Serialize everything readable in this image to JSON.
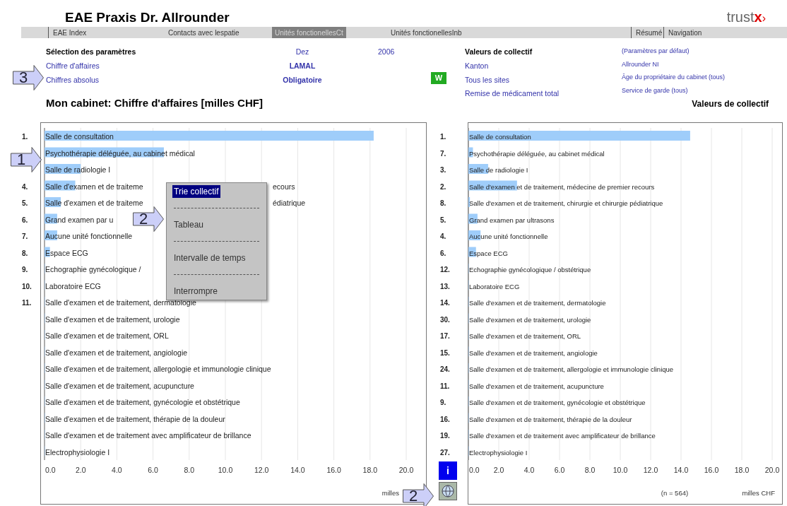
{
  "header": {
    "title": "EAE Praxis Dr. Allrounder",
    "logo": {
      "text": "trust",
      "accent": "x",
      "mark": "›"
    }
  },
  "nav": [
    {
      "label": "EAE Index",
      "selected": false,
      "divider": true
    },
    {
      "label": "Contacts avec lespatie",
      "selected": false,
      "divider": false
    },
    {
      "label": "Unités fonctionellesCt",
      "selected": true,
      "divider": false
    },
    {
      "label": "Unités fonctionellesInb",
      "selected": false,
      "divider": false
    },
    {
      "label": "Résumé",
      "selected": false,
      "divider": true
    },
    {
      "label": "Navigation",
      "selected": false,
      "divider": true
    }
  ],
  "parameters": {
    "selection": {
      "heading": "Sélection des paramètres",
      "items": [
        "Chiffre d'affaires",
        "Chiffres absolus"
      ]
    },
    "period": [
      "Dez",
      "2006"
    ],
    "insurance": [
      "LAMAL",
      "Obligatoire"
    ],
    "w_button": "W",
    "collective": {
      "heading": "Valeurs de collectif",
      "items": [
        "Kanton",
        "Tous les sites",
        "Remise de médicament total"
      ]
    },
    "defaults": [
      "(Paramètres par défaut)",
      "Allrounder NI",
      "Âge du propriétaire du cabinet (tous)",
      "Service de garde (tous)"
    ]
  },
  "left_panel": {
    "title": "Mon cabinet: Chiffre d'affaires [milles CHF]",
    "ranks_above_callout": [
      "1."
    ],
    "ranks": [
      "4.",
      "5.",
      "6.",
      "7.",
      "8.",
      "9.",
      "10.",
      "11."
    ],
    "label_tails": [
      "ecours",
      "édiatrique"
    ],
    "chart_data": {
      "type": "bar",
      "orientation": "horizontal",
      "grid": true,
      "xlabel": "milles",
      "categories": [
        "Salle de consultation",
        "Psychothérapie déléguée, au cabinet médical",
        "Salle de radiologie I",
        "Salle d'examen et de traiteme",
        "Salle d'examen et de traiteme",
        "Grand examen par u",
        "Aucune unité fonctionnelle",
        "Espace ECG",
        "Echographie gynécologique /",
        "Laboratoire ECG",
        "Salle d'examen et de traitement, dermatologie",
        "Salle d'examen et de traitement, urologie",
        "Salle d'examen et de traitement, ORL",
        "Salle d'examen et de traitement, angiologie",
        "Salle d'examen et de traitement, allergologie et immunologie clinique",
        "Salle d'examen et de traitement, acupuncture",
        "Salle d'examen et de traitement, gynécologie et obstétrique",
        "Salle d'examen et de traitement, thérapie de la douleur",
        "Salle d'examen et de traitement avec amplificateur de brillance",
        "Electrophysiologie I"
      ],
      "values": [
        18.2,
        6.6,
        2.0,
        1.7,
        0.9,
        0.7,
        0.7,
        0.3,
        0,
        0,
        0,
        0,
        0,
        0,
        0,
        0,
        0,
        0,
        0,
        0
      ],
      "xlim": [
        0,
        20
      ],
      "xticks": [
        {
          "value": 0,
          "label": "0.0"
        },
        {
          "value": 2,
          "label": "2.0"
        },
        {
          "value": 4,
          "label": "4.0"
        },
        {
          "value": 6,
          "label": "6.0"
        },
        {
          "value": 8,
          "label": "8.0"
        },
        {
          "value": 10,
          "label": "10.0"
        },
        {
          "value": 12,
          "label": "12.0"
        },
        {
          "value": 14,
          "label": "14.0"
        },
        {
          "value": 16,
          "label": "16.0"
        },
        {
          "value": 18,
          "label": "18.0"
        },
        {
          "value": 20,
          "label": "20.0"
        }
      ]
    }
  },
  "right_panel": {
    "title": "Valeurs de collectif",
    "ranks": [
      "1.",
      "7.",
      "3.",
      "2.",
      "8.",
      "5.",
      "4.",
      "6.",
      "12.",
      "13.",
      "14.",
      "30.",
      "17.",
      "15.",
      "24.",
      "11.",
      "9.",
      "16.",
      "19.",
      "27."
    ],
    "note": "(n = 564)",
    "chart_data": {
      "type": "bar",
      "orientation": "horizontal",
      "grid": true,
      "xlabel": "milles CHF",
      "categories": [
        "Salle de consultation",
        "Psychothérapie déléguée, au cabinet médical",
        "Salle de radiologie I",
        "Salle d'examen et de traitement, médecine de premier recours",
        "Salle d'examen et de traitement, chirurgie et chirurgie pédiatrique",
        "Grand examen par ultrasons",
        "Aucune unité fonctionnelle",
        "Espace ECG",
        "Echographie gynécologique / obstétrique",
        "Laboratoire ECG",
        "Salle d'examen et de traitement, dermatologie",
        "Salle d'examen et de traitement, urologie",
        "Salle d'examen et de traitement, ORL",
        "Salle d'examen et de traitement, angiologie",
        "Salle d'examen et de traitement, allergologie et immunologie clinique",
        "Salle d'examen et de traitement, acupuncture",
        "Salle d'examen et de traitement, gynécologie et obstétrique",
        "Salle d'examen et de traitement, thérapie de la douleur",
        "Salle d'examen et de traitement avec amplificateur de brillance",
        "Electrophysiologie I"
      ],
      "values": [
        14.6,
        0.3,
        1.3,
        3.2,
        0.1,
        0.6,
        0.8,
        0.5,
        0,
        0,
        0,
        0,
        0,
        0,
        0,
        0,
        0,
        0,
        0,
        0
      ],
      "xlim": [
        0,
        20
      ],
      "xticks": [
        {
          "value": 0,
          "label": "0.0"
        },
        {
          "value": 2,
          "label": "2.0"
        },
        {
          "value": 4,
          "label": "4.0"
        },
        {
          "value": 6,
          "label": "6.0"
        },
        {
          "value": 8,
          "label": "8.0"
        },
        {
          "value": 10,
          "label": "10.0"
        },
        {
          "value": 12,
          "label": "12.0"
        },
        {
          "value": 14,
          "label": "14.0"
        },
        {
          "value": 16,
          "label": "16.0"
        },
        {
          "value": 18,
          "label": "18.0"
        },
        {
          "value": 20,
          "label": "20.0"
        }
      ]
    }
  },
  "info_button": "i",
  "context_menu": [
    {
      "kind": "item",
      "label": "Trie collectif",
      "selected": true
    },
    {
      "kind": "separator"
    },
    {
      "kind": "item",
      "label": "Tableau",
      "selected": false
    },
    {
      "kind": "separator"
    },
    {
      "kind": "item",
      "label": "Intervalle de temps",
      "selected": false
    },
    {
      "kind": "separator"
    },
    {
      "kind": "item",
      "label": "Interrompre",
      "selected": false
    }
  ],
  "callouts": [
    {
      "number": "3"
    },
    {
      "number": "1"
    },
    {
      "number": "2"
    },
    {
      "number": "2"
    }
  ]
}
